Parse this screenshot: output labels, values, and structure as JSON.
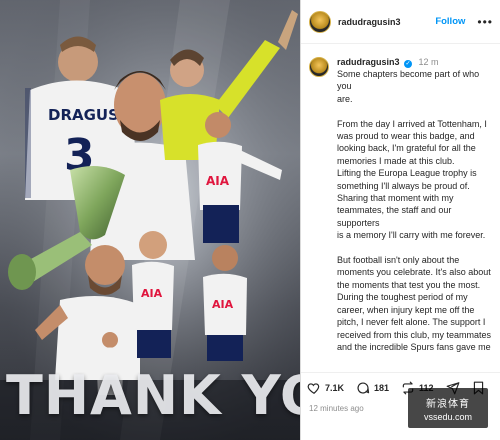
{
  "post": {
    "image": {
      "big_text": "THANK YOU",
      "jersey_name": "DRAGUSIN",
      "jersey_number": "3",
      "sponsor": "AIA",
      "colors": {
        "kit_white": "#f2f2f2",
        "kit_navy": "#132257",
        "gk_yellow": "#d7e12a",
        "trophy": "#8bb36a"
      }
    },
    "header": {
      "username": "radudragusin3",
      "follow_label": "Follow",
      "more_icon": "ellipsis-icon"
    },
    "caption": {
      "username": "radudragusin3",
      "time": "12 m",
      "lines": [
        "Some chapters become part of who you",
        "are.",
        "",
        "From the day I arrived at Tottenham, I",
        "was proud to wear this badge, and",
        "looking back, I'm grateful for all the",
        "memories I made at this club.",
        "Lifting the Europa League trophy is",
        "something I'll always be proud of.",
        "Sharing that moment with my",
        "teammates, the staff and our supporters",
        "is a memory I'll carry with me forever.",
        "",
        "But football isn't only about the",
        "moments you celebrate. It's also about",
        "the moments that test you the most.",
        "During the toughest period of my",
        "career, when injury kept me off the",
        "pitch, I never felt alone. The support I",
        "received from this club, my teammates",
        "and the incredible Spurs fans gave me"
      ]
    },
    "actions": {
      "likes": "7.1K",
      "comments": "181",
      "shares": "112",
      "icons": [
        "heart-icon",
        "comment-icon",
        "repost-icon",
        "share-icon",
        "bookmark-icon"
      ]
    },
    "timestamp": "12 minutes ago"
  },
  "watermark": {
    "line1": "新浪体育",
    "line2": "vssedu.com"
  }
}
